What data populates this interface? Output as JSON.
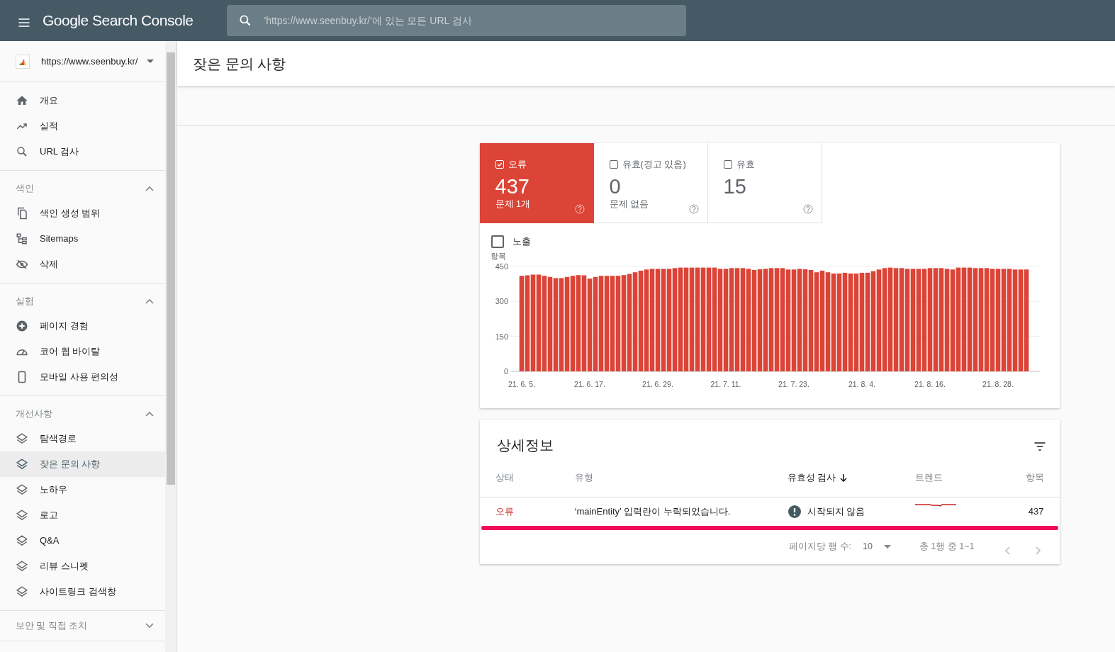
{
  "header": {
    "logo_text": "Google Search Console",
    "search_placeholder": "'https://www.seenbuy.kr/'에 있는 모든 URL 검사"
  },
  "property": {
    "url": "https://www.seenbuy.kr/"
  },
  "sidebar": {
    "sections": [
      {
        "items": [
          {
            "label": "개요",
            "selected": false
          },
          {
            "label": "실적",
            "selected": false
          },
          {
            "label": "URL 검사",
            "selected": false
          }
        ]
      },
      {
        "title": "색인",
        "expanded": true,
        "items": [
          {
            "label": "색인 생성 범위",
            "selected": false
          },
          {
            "label": "Sitemaps",
            "selected": false
          },
          {
            "label": "삭제",
            "selected": false
          }
        ]
      },
      {
        "title": "실험",
        "expanded": true,
        "items": [
          {
            "label": "페이지 경험",
            "selected": false
          },
          {
            "label": "코어 웹 바이탈",
            "selected": false
          },
          {
            "label": "모바일 사용 편의성",
            "selected": false
          }
        ]
      },
      {
        "title": "개선사항",
        "expanded": true,
        "items": [
          {
            "label": "탐색경로",
            "selected": false
          },
          {
            "label": "잦은 문의 사항",
            "selected": true
          },
          {
            "label": "노하우",
            "selected": false
          },
          {
            "label": "로고",
            "selected": false
          },
          {
            "label": "Q&A",
            "selected": false
          },
          {
            "label": "리뷰 스니펫",
            "selected": false
          },
          {
            "label": "사이트링크 검색창",
            "selected": false
          }
        ]
      },
      {
        "title": "보안 및 직접 조치",
        "expanded": false
      }
    ]
  },
  "page_title": "잦은 문의 사항",
  "summary_tiles": [
    {
      "kind": "error",
      "label": "오류",
      "count": "437",
      "subtitle": "문제 1개",
      "checked": true
    },
    {
      "kind": "warning",
      "label": "유효(경고 있음)",
      "count": "0",
      "subtitle": "문제 없음",
      "checked": false
    },
    {
      "kind": "valid",
      "label": "유효",
      "count": "15",
      "checked": false
    }
  ],
  "impressions": {
    "label": "노출",
    "checked": false
  },
  "chart_data": {
    "type": "bar",
    "ylabel": "항목",
    "categories": [
      "21. 6. 5.",
      null,
      null,
      null,
      null,
      null,
      null,
      null,
      null,
      null,
      null,
      null,
      "21. 6. 17.",
      null,
      null,
      null,
      null,
      null,
      null,
      null,
      null,
      null,
      null,
      null,
      "21. 6. 29.",
      null,
      null,
      null,
      null,
      null,
      null,
      null,
      null,
      null,
      null,
      null,
      "21. 7. 11.",
      null,
      null,
      null,
      null,
      null,
      null,
      null,
      null,
      null,
      null,
      null,
      "21. 7. 23.",
      null,
      null,
      null,
      null,
      null,
      null,
      null,
      null,
      null,
      null,
      null,
      "21. 8. 4.",
      null,
      null,
      null,
      null,
      null,
      null,
      null,
      null,
      null,
      null,
      null,
      "21. 8. 16.",
      null,
      null,
      null,
      null,
      null,
      null,
      null,
      null,
      null,
      null,
      null,
      "21. 8. 28.",
      null,
      null,
      null,
      null,
      null
    ],
    "series": [
      {
        "color": "#db4437",
        "values": [
          410,
          412,
          415,
          415,
          410,
          405,
          400,
          400,
          405,
          410,
          413,
          412,
          398,
          405,
          410,
          410,
          410,
          410,
          413,
          418,
          425,
          432,
          437,
          440,
          440,
          440,
          440,
          443,
          445,
          445,
          445,
          445,
          445,
          445,
          445,
          440,
          440,
          443,
          443,
          443,
          440,
          435,
          438,
          440,
          443,
          443,
          443,
          437,
          437,
          440,
          438,
          435,
          425,
          432,
          425,
          420,
          420,
          423,
          420,
          420,
          423,
          423,
          430,
          437,
          443,
          445,
          443,
          443,
          440,
          440,
          440,
          440,
          443,
          443,
          443,
          440,
          437,
          445,
          445,
          445,
          443,
          443,
          443,
          440,
          440,
          440,
          440,
          437,
          437,
          437
        ]
      }
    ],
    "ylim": [
      0,
      450
    ],
    "yticks": [
      0,
      150,
      300,
      450
    ]
  },
  "details": {
    "title": "상세정보",
    "columns": [
      {
        "label": "상태",
        "sorted": false
      },
      {
        "label": "유형",
        "sorted": false
      },
      {
        "label": "유효성 검사",
        "sorted": true
      },
      {
        "label": "트렌드",
        "sorted": false
      },
      {
        "label": "항목",
        "sorted": false
      }
    ],
    "rows": [
      {
        "status": "오류",
        "type": "‘mainEntity’ 입력란이 누락되었습니다.",
        "validation": "시작되지 않음",
        "count": "437",
        "highlighted": true
      }
    ],
    "pagination": {
      "rows_per_page_label": "페이지당 행 수:",
      "rows_per_page": "10",
      "range": "총 1행 중 1~1"
    }
  }
}
